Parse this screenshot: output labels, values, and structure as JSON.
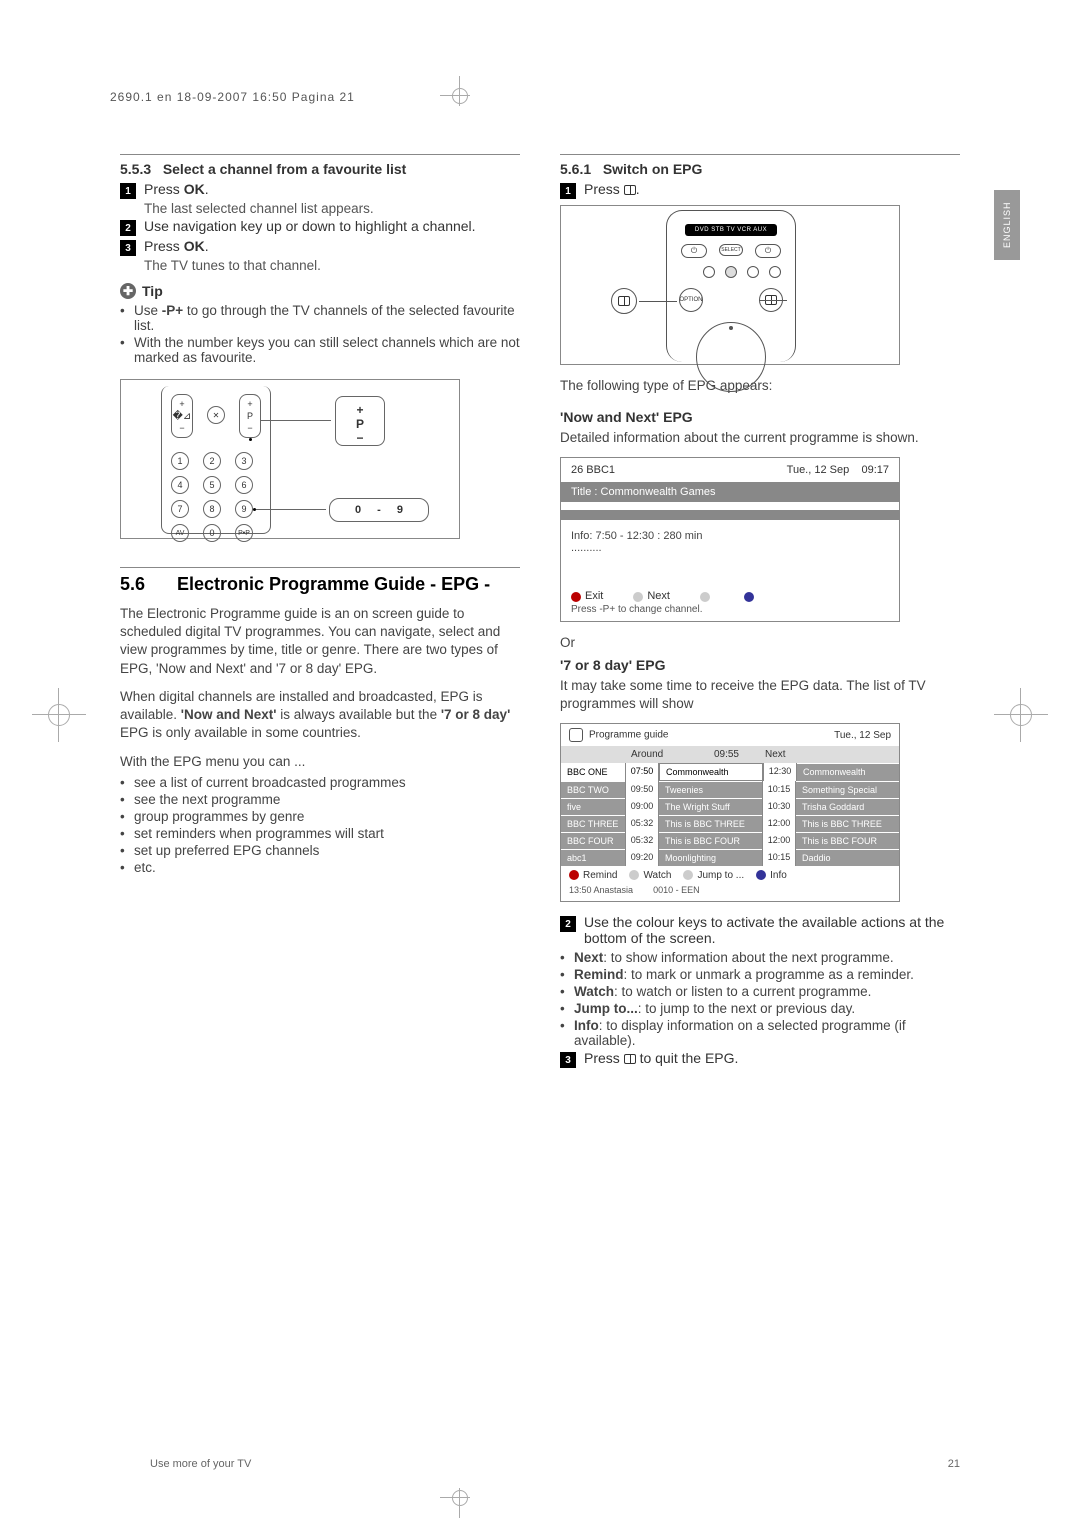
{
  "header": "2690.1 en  18-09-2007  16:50  Pagina 21",
  "side_tab": "ENGLISH",
  "left": {
    "sec553_num": "5.5.3",
    "sec553_title": "Select a channel from a favourite list",
    "step1_a": "Press ",
    "step1_b": "OK",
    "step1_c": ".",
    "step1_sub": "The last selected channel list appears.",
    "step2": "Use navigation key up or down to highlight a channel.",
    "step3_a": "Press ",
    "step3_b": "OK",
    "step3_c": ".",
    "step3_sub": "The TV tunes to that channel.",
    "tip_label": "Tip",
    "tip1_a": "Use ",
    "tip1_b": "-P+",
    "tip1_c": " to go through the TV channels of the selected favourite list.",
    "tip2": "With the number keys you can still select channels which are not marked as favourite.",
    "sec56_num": "5.6",
    "sec56_title": "Electronic Programme Guide - EPG -",
    "p1": "The Electronic Programme guide is an on screen guide to scheduled digital TV programmes. You can navigate, select and view programmes by time, title or genre. There are two types of EPG, 'Now and Next' and '7 or 8 day' EPG.",
    "p2_a": "When digital channels are installed and broadcasted, EPG is available. ",
    "p2_b": "'Now and Next'",
    "p2_c": " is always available but the ",
    "p2_d": "'7 or 8 day'",
    "p2_e": " EPG is only available in some countries.",
    "p3": "With the EPG menu you can ...",
    "menu_items": [
      "see a list of current broadcasted programmes",
      "see the next programme",
      "group programmes by genre",
      "set reminders when programmes will start",
      "set up preferred EPG channels",
      "etc."
    ]
  },
  "right": {
    "sec561_num": "5.6.1",
    "sec561_title": "Switch on EPG",
    "step1_a": "Press ",
    "step1_c": ".",
    "device_modes": "DVD STB TV VCR AUX",
    "caption1": "The following type of EPG appears:",
    "nn_title": "'Now and Next' EPG",
    "nn_desc": "Detailed information about the current programme is shown.",
    "epg1": {
      "ch": "26   BBC1",
      "date": "Tue., 12 Sep",
      "time": "09:17",
      "title_lbl": "Title : Commonwealth Games",
      "info": "Info: 7:50 - 12:30 : 280 min",
      "dots": "..........",
      "exit": "Exit",
      "next": "Next",
      "foot_note": "Press -P+ to change channel."
    },
    "or": "Or",
    "d7_title": "'7 or 8 day' EPG",
    "d7_desc": "It may take some time to receive the EPG data. The list of TV programmes will show",
    "epg2": {
      "head": "Programme guide",
      "date": "Tue., 12 Sep",
      "col_around": "Around",
      "col_time": "09:55",
      "col_next": "Next",
      "rows": [
        {
          "ch": "BBC ONE",
          "t1": "07:50",
          "p1": "Commonwealth",
          "t2": "12:30",
          "p2": "Commonwealth"
        },
        {
          "ch": "BBC TWO",
          "t1": "09:50",
          "p1": "Tweenies",
          "t2": "10:15",
          "p2": "Something Special"
        },
        {
          "ch": "five",
          "t1": "09:00",
          "p1": "The Wright Stuff",
          "t2": "10:30",
          "p2": "Trisha Goddard"
        },
        {
          "ch": "BBC THREE",
          "t1": "05:32",
          "p1": "This is BBC THREE",
          "t2": "12:00",
          "p2": "This is BBC THREE"
        },
        {
          "ch": "BBC FOUR",
          "t1": "05:32",
          "p1": "This is BBC FOUR",
          "t2": "12:00",
          "p2": "This is BBC FOUR"
        },
        {
          "ch": "abc1",
          "t1": "09:20",
          "p1": "Moonlighting",
          "t2": "10:15",
          "p2": "Daddio"
        }
      ],
      "foot_remind": "Remind",
      "foot_watch": "Watch",
      "foot_jump": "Jump to ...",
      "foot_info": "Info",
      "foot2_a": "13:50   Anastasia",
      "foot2_b": "0010 - EEN"
    },
    "step2": "Use the colour keys to activate the available actions at the bottom of the screen.",
    "b_next_a": "Next",
    "b_next_b": ": to show information about the next programme.",
    "b_remind_a": "Remind",
    "b_remind_b": ": to mark or unmark a programme as a reminder.",
    "b_watch_a": "Watch",
    "b_watch_b": ": to watch or listen to a current programme.",
    "b_jump_a": "Jump to...",
    "b_jump_b": ": to jump to the next or previous day.",
    "b_info_a": "Info",
    "b_info_b": ": to display information on a selected programme (if available).",
    "step3_a": "Press ",
    "step3_c": " to quit the EPG."
  },
  "footer_left": "Use more of your TV",
  "footer_right": "21"
}
